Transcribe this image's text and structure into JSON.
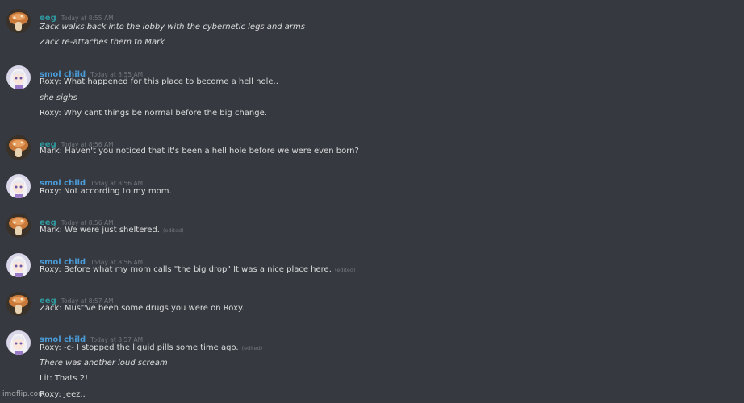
{
  "messages": [
    {
      "author": "eeg",
      "timestamp": "Today at 8:55 AM",
      "lines": [
        {
          "text": "Zack walks back into the lobby with the cybernetic legs and arms",
          "italic": true
        },
        {
          "text": "Zack re-attaches them to Mark",
          "italic": true
        }
      ]
    },
    {
      "author": "smol child",
      "timestamp": "Today at 8:55 AM",
      "lines": [
        {
          "text": "Roxy: What happened for this place to become a hell hole..",
          "italic": false
        },
        {
          "text": "she sighs",
          "italic": true
        },
        {
          "text": "Roxy: Why cant things be normal before the big change.",
          "italic": false
        }
      ]
    },
    {
      "author": "eeg",
      "timestamp": "Today at 8:56 AM",
      "lines": [
        {
          "text": "Mark: Haven't you noticed that it's been a hell hole before we were even born?",
          "italic": false
        }
      ]
    },
    {
      "author": "smol child",
      "timestamp": "Today at 8:56 AM",
      "lines": [
        {
          "text": "Roxy: Not according to my mom.",
          "italic": false
        }
      ]
    },
    {
      "author": "eeg",
      "timestamp": "Today at 8:56 AM",
      "lines": [
        {
          "text": "Mark: We were just sheltered.",
          "italic": false,
          "edited": "(edited)"
        }
      ]
    },
    {
      "author": "smol child",
      "timestamp": "Today at 8:56 AM",
      "lines": [
        {
          "text": "Roxy: Before what my mom  calls \"the big drop\" It was a nice place here.",
          "italic": false,
          "edited": "(edited)"
        }
      ]
    },
    {
      "author": "eeg",
      "timestamp": "Today at 8:57 AM",
      "lines": [
        {
          "text": "Zack: Must've been some drugs you were on Roxy.",
          "italic": false
        }
      ]
    },
    {
      "author": "smol child",
      "timestamp": "Today at 8:57 AM",
      "lines": [
        {
          "text": "Roxy: -c- I stopped the liquid pills some time ago.",
          "italic": false,
          "edited": "(edited)"
        },
        {
          "text": "There was another loud scream",
          "italic": true
        },
        {
          "text": "Lit: Thats 2!",
          "italic": false
        },
        {
          "text": "Roxy: Jeez..",
          "italic": false
        }
      ]
    }
  ],
  "avatars": {
    "eeg": "mushroom-avatar-icon",
    "smol child": "anime-girl-avatar-icon"
  },
  "colors": {
    "background": "#36393f",
    "eeg_name": "#2e9aa0",
    "smol_name": "#4a9bd8",
    "timestamp": "#72767d",
    "text": "#dcddde"
  },
  "watermark": "imgflip.com"
}
